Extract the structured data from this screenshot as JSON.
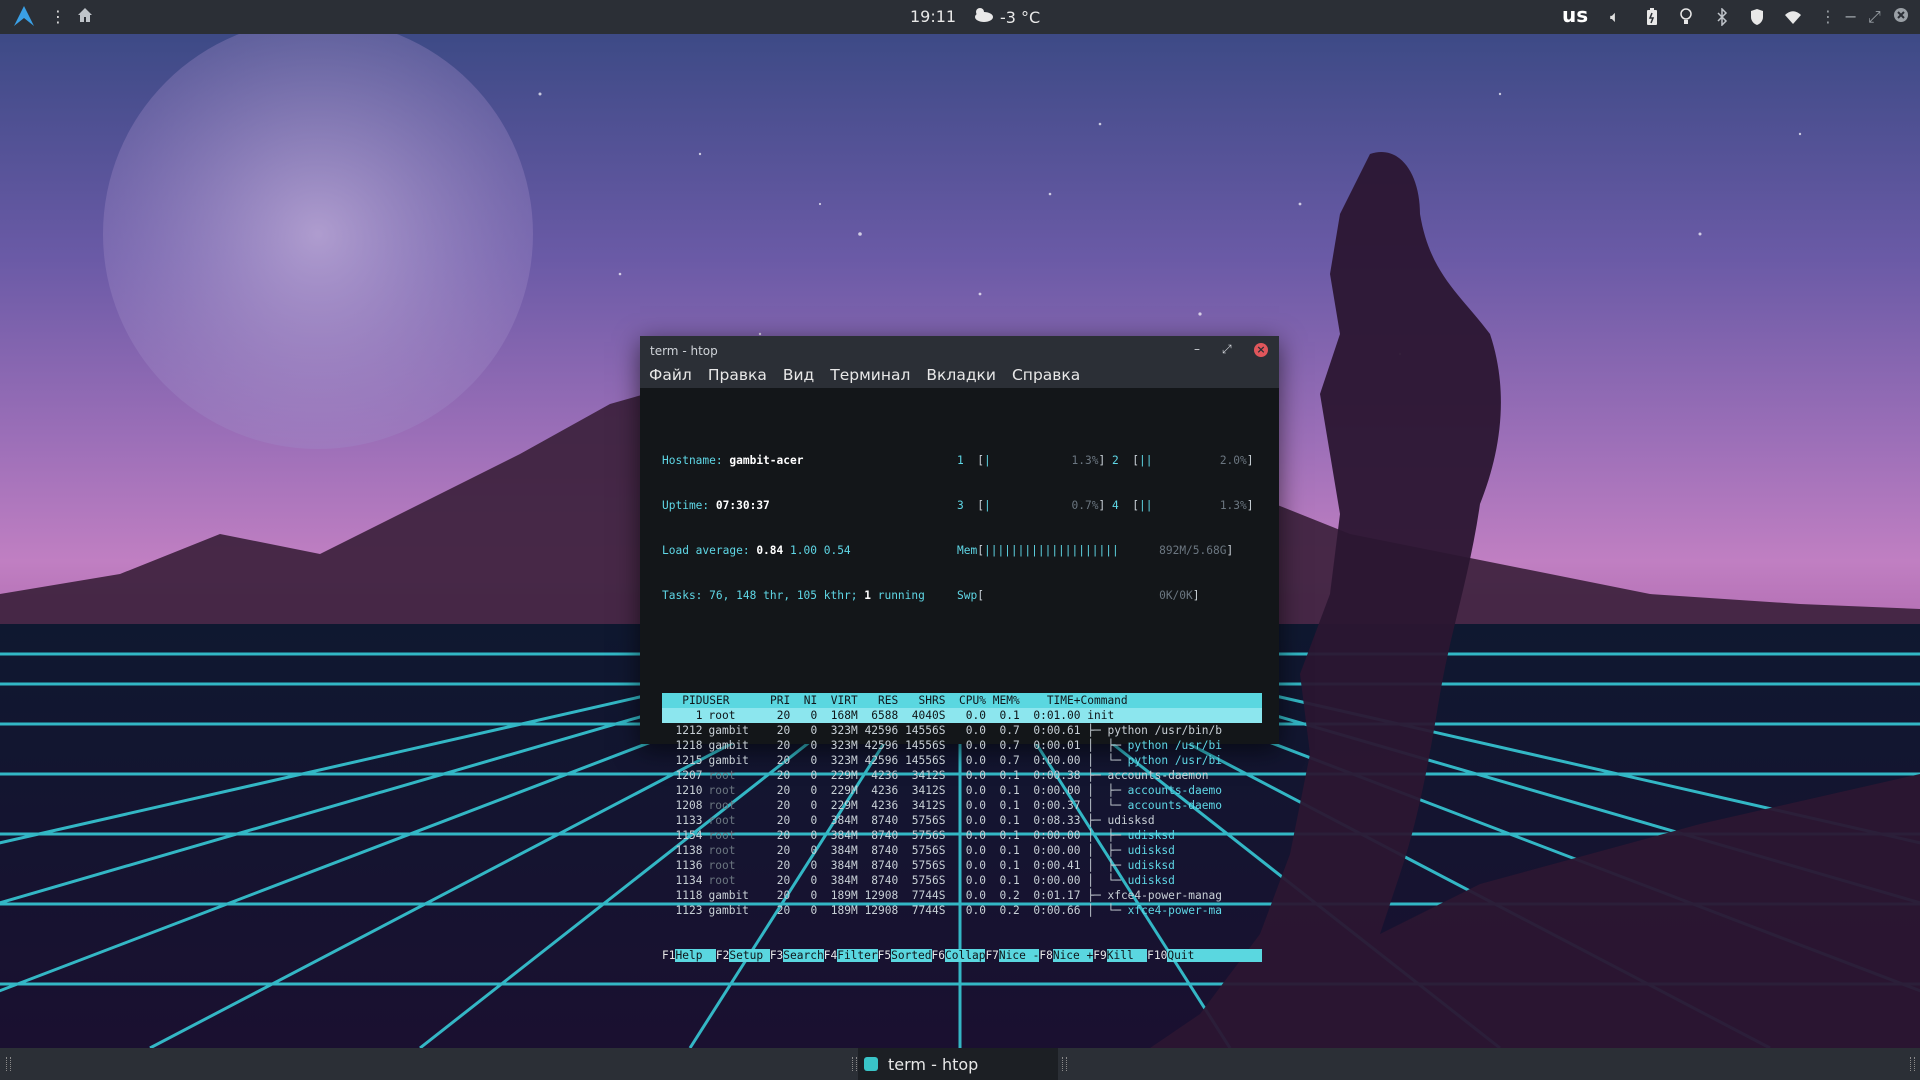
{
  "topbar": {
    "clock": "19:11",
    "weather": "-3 °C",
    "keyboard_layout": "us",
    "icons": [
      "arch-logo-icon",
      "menu-dots-icon",
      "home-icon",
      "weather-cloud-icon",
      "volume-icon",
      "battery-icon",
      "lightbulb-icon",
      "bluetooth-icon",
      "shield-icon",
      "wifi-icon",
      "menu-dots-icon",
      "minimize-icon",
      "restore-icon",
      "close-icon"
    ]
  },
  "window": {
    "title": "term - htop",
    "menu": [
      "Файл",
      "Правка",
      "Вид",
      "Терминал",
      "Вкладки",
      "Справка"
    ]
  },
  "htop": {
    "hostname_label": "Hostname:",
    "hostname": "gambit-acer",
    "uptime_label": "Uptime:",
    "uptime": "07:30:37",
    "load_label": "Load average:",
    "load1": "0.84",
    "load5": "1.00",
    "load15": "0.54",
    "tasks_label": "Tasks:",
    "tasks": "76,",
    "thr": "148",
    "thr_label": "thr,",
    "kthr": "105",
    "kthr_label": "kthr;",
    "running": "1",
    "running_label": "running",
    "cpu": [
      {
        "id": "1",
        "pct": "1.3%",
        "level": 0.013
      },
      {
        "id": "2",
        "pct": "2.0%",
        "level": 0.02
      },
      {
        "id": "3",
        "pct": "0.7%",
        "level": 0.007
      },
      {
        "id": "4",
        "pct": "1.3%",
        "level": 0.013
      }
    ],
    "mem_label": "Mem",
    "mem": "892M/5.68G",
    "swp_label": "Swp",
    "swp": "0K/0K",
    "columns": [
      "PID",
      "USER",
      "PRI",
      "NI",
      "VIRT",
      "RES",
      "SHR",
      "S",
      "CPU%",
      "MEM%",
      "TIME+",
      "Command"
    ],
    "processes": [
      {
        "pid": "1",
        "user": "root",
        "pri": "20",
        "ni": "0",
        "virt": "168M",
        "res": "6588",
        "shr": "4040",
        "s": "S",
        "cpu": "0.0",
        "mem": "0.1",
        "time": "0:01.00",
        "cmd": "init",
        "tree": "",
        "selected": true
      },
      {
        "pid": "1212",
        "user": "gambit",
        "pri": "20",
        "ni": "0",
        "virt": "323M",
        "res": "42596",
        "shr": "14556",
        "s": "S",
        "cpu": "0.0",
        "mem": "0.7",
        "time": "0:00.61",
        "cmd": "python /usr/bin/b",
        "tree": "├─ "
      },
      {
        "pid": "1218",
        "user": "gambit",
        "pri": "20",
        "ni": "0",
        "virt": "323M",
        "res": "42596",
        "shr": "14556",
        "s": "S",
        "cpu": "0.0",
        "mem": "0.7",
        "time": "0:00.01",
        "cmd": "python /usr/bi",
        "tree": "│  ├─ ",
        "thread": true
      },
      {
        "pid": "1215",
        "user": "gambit",
        "pri": "20",
        "ni": "0",
        "virt": "323M",
        "res": "42596",
        "shr": "14556",
        "s": "S",
        "cpu": "0.0",
        "mem": "0.7",
        "time": "0:00.00",
        "cmd": "python /usr/bi",
        "tree": "│  └─ ",
        "thread": true
      },
      {
        "pid": "1207",
        "user": "root",
        "pri": "20",
        "ni": "0",
        "virt": "229M",
        "res": "4236",
        "shr": "3412",
        "s": "S",
        "cpu": "0.0",
        "mem": "0.1",
        "time": "0:00.38",
        "cmd": "accounts-daemon",
        "tree": "├─ ",
        "dimuser": true
      },
      {
        "pid": "1210",
        "user": "root",
        "pri": "20",
        "ni": "0",
        "virt": "229M",
        "res": "4236",
        "shr": "3412",
        "s": "S",
        "cpu": "0.0",
        "mem": "0.1",
        "time": "0:00.00",
        "cmd": "accounts-daemo",
        "tree": "│  ├─ ",
        "thread": true,
        "dimuser": true
      },
      {
        "pid": "1208",
        "user": "root",
        "pri": "20",
        "ni": "0",
        "virt": "229M",
        "res": "4236",
        "shr": "3412",
        "s": "S",
        "cpu": "0.0",
        "mem": "0.1",
        "time": "0:00.37",
        "cmd": "accounts-daemo",
        "tree": "│  └─ ",
        "thread": true,
        "dimuser": true
      },
      {
        "pid": "1133",
        "user": "root",
        "pri": "20",
        "ni": "0",
        "virt": "384M",
        "res": "8740",
        "shr": "5756",
        "s": "S",
        "cpu": "0.0",
        "mem": "0.1",
        "time": "0:08.33",
        "cmd": "udisksd",
        "tree": "├─ ",
        "dimuser": true
      },
      {
        "pid": "1154",
        "user": "root",
        "pri": "20",
        "ni": "0",
        "virt": "384M",
        "res": "8740",
        "shr": "5756",
        "s": "S",
        "cpu": "0.0",
        "mem": "0.1",
        "time": "0:00.00",
        "cmd": "udisksd",
        "tree": "│  ├─ ",
        "thread": true,
        "dimuser": true
      },
      {
        "pid": "1138",
        "user": "root",
        "pri": "20",
        "ni": "0",
        "virt": "384M",
        "res": "8740",
        "shr": "5756",
        "s": "S",
        "cpu": "0.0",
        "mem": "0.1",
        "time": "0:00.00",
        "cmd": "udisksd",
        "tree": "│  ├─ ",
        "thread": true,
        "dimuser": true
      },
      {
        "pid": "1136",
        "user": "root",
        "pri": "20",
        "ni": "0",
        "virt": "384M",
        "res": "8740",
        "shr": "5756",
        "s": "S",
        "cpu": "0.0",
        "mem": "0.1",
        "time": "0:00.41",
        "cmd": "udisksd",
        "tree": "│  ├─ ",
        "thread": true,
        "dimuser": true
      },
      {
        "pid": "1134",
        "user": "root",
        "pri": "20",
        "ni": "0",
        "virt": "384M",
        "res": "8740",
        "shr": "5756",
        "s": "S",
        "cpu": "0.0",
        "mem": "0.1",
        "time": "0:00.00",
        "cmd": "udisksd",
        "tree": "│  └─ ",
        "thread": true,
        "dimuser": true
      },
      {
        "pid": "1118",
        "user": "gambit",
        "pri": "20",
        "ni": "0",
        "virt": "189M",
        "res": "12908",
        "shr": "7744",
        "s": "S",
        "cpu": "0.0",
        "mem": "0.2",
        "time": "0:01.17",
        "cmd": "xfce4-power-manag",
        "tree": "├─ "
      },
      {
        "pid": "1123",
        "user": "gambit",
        "pri": "20",
        "ni": "0",
        "virt": "189M",
        "res": "12908",
        "shr": "7744",
        "s": "S",
        "cpu": "0.0",
        "mem": "0.2",
        "time": "0:00.66",
        "cmd": "xfce4-power-ma",
        "tree": "│  └─ ",
        "thread": true
      }
    ],
    "fkeys": [
      {
        "key": "F1",
        "label": "Help  "
      },
      {
        "key": "F2",
        "label": "Setup "
      },
      {
        "key": "F3",
        "label": "Search"
      },
      {
        "key": "F4",
        "label": "Filter"
      },
      {
        "key": "F5",
        "label": "Sorted"
      },
      {
        "key": "F6",
        "label": "Collap"
      },
      {
        "key": "F7",
        "label": "Nice -"
      },
      {
        "key": "F8",
        "label": "Nice +"
      },
      {
        "key": "F9",
        "label": "Kill  "
      },
      {
        "key": "F10",
        "label": "Quit  "
      }
    ]
  },
  "taskbar": {
    "item_label": "term - htop"
  }
}
